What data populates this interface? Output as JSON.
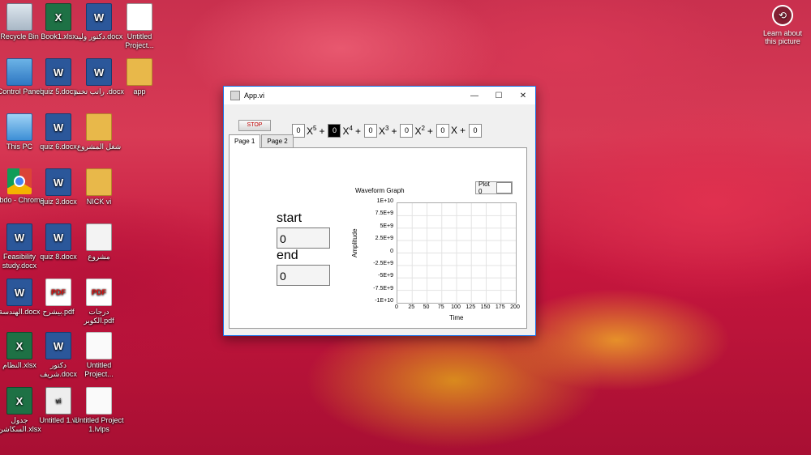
{
  "desktop": {
    "icons": [
      {
        "label": "Recycle Bin",
        "glyph": "",
        "kind": "bin"
      },
      {
        "label": "Book1.xlsx",
        "glyph": "X",
        "kind": "excel"
      },
      {
        "label": "دكتور وليد.docx",
        "glyph": "W",
        "kind": "word"
      },
      {
        "label": "Untitled Project...",
        "glyph": "",
        "kind": "nb"
      },
      {
        "label": "Control Panel",
        "glyph": "",
        "kind": "cpanel"
      },
      {
        "label": "quiz 5.docx",
        "glyph": "W",
        "kind": "word"
      },
      {
        "label": "راتب تختم .docx",
        "glyph": "W",
        "kind": "word"
      },
      {
        "label": "app",
        "glyph": "",
        "kind": "folder"
      },
      {
        "label": "This PC",
        "glyph": "",
        "kind": "pc"
      },
      {
        "label": "quiz 6.docx",
        "glyph": "W",
        "kind": "word"
      },
      {
        "label": "شغل المشروع",
        "glyph": "",
        "kind": "folder"
      },
      {
        "label": "Abdo - Chrome",
        "glyph": "",
        "kind": "chrome"
      },
      {
        "label": "quiz 3.docx",
        "glyph": "W",
        "kind": "word"
      },
      {
        "label": "NICK vi",
        "glyph": "",
        "kind": "folder"
      },
      {
        "label": "Feasibility study.docx",
        "glyph": "W",
        "kind": "word"
      },
      {
        "label": "quiz 8.docx",
        "glyph": "W",
        "kind": "word"
      },
      {
        "label": "مشروع",
        "glyph": "",
        "kind": "image"
      },
      {
        "label": "الهندسة.docx",
        "glyph": "W",
        "kind": "word"
      },
      {
        "label": "بيشرح.pdf",
        "glyph": "PDF",
        "kind": "pdf"
      },
      {
        "label": "درجات الكوبر.pdf",
        "glyph": "PDF",
        "kind": "pdf"
      },
      {
        "label": "النظام.xlsx",
        "glyph": "X",
        "kind": "excel"
      },
      {
        "label": "دكتور شريف.docx",
        "glyph": "W",
        "kind": "word"
      },
      {
        "label": "Untitled Project...",
        "glyph": "",
        "kind": "blank"
      },
      {
        "label": "جدول السكاشن.xlsx",
        "glyph": "X",
        "kind": "excel"
      },
      {
        "label": "Untitled 1.vi",
        "glyph": "vi",
        "kind": "vi"
      },
      {
        "label": "Untitled Project 1.lvlps",
        "glyph": "",
        "kind": "blank"
      }
    ],
    "learn_label": "Learn about this picture"
  },
  "window": {
    "title": "App.vi",
    "minimize": "—",
    "maximize": "☐",
    "close": "✕",
    "stop_label": "STOP",
    "coefficients": [
      "0",
      "0",
      "0",
      "0",
      "0",
      "0"
    ],
    "terms": [
      "X",
      "X",
      "X",
      "X",
      "X",
      ""
    ],
    "powers": [
      "5",
      "4",
      "3",
      "2",
      "",
      ""
    ],
    "plus": "+",
    "tabs": [
      "Page 1",
      "Page 2"
    ],
    "start_label": "start",
    "start_value": "0",
    "end_label": "end",
    "end_value": "0",
    "graph": {
      "title": "Waveform Graph",
      "legend": "Plot 0",
      "xlabel": "Time",
      "ylabel": "Amplitude",
      "yticks": [
        "1E+10",
        "7.5E+9",
        "5E+9",
        "2.5E+9",
        "0",
        "-2.5E+9",
        "-5E+9",
        "-7.5E+9",
        "-1E+10"
      ],
      "xticks": [
        "0",
        "25",
        "50",
        "75",
        "100",
        "125",
        "150",
        "175",
        "200"
      ]
    }
  },
  "colors": {
    "window_border": "#1a73e8",
    "stop_text": "#c00000",
    "grid": "#e3e3e3"
  }
}
